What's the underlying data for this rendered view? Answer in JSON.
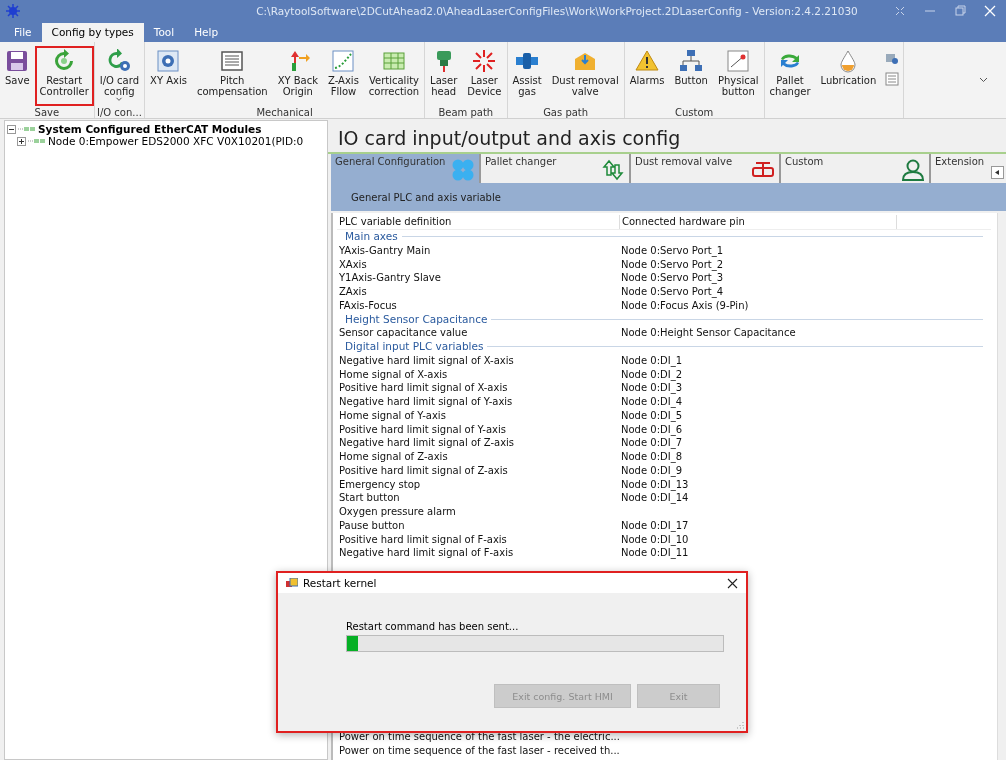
{
  "window": {
    "title": "C:\\RaytoolSoftware\\2DCutAhead2.0\\AheadLaserConfigFiles\\Work\\WorkProject.2DLaserConfig - Version:2.4.2.21030"
  },
  "menu_tabs": [
    {
      "label": "File",
      "selected": false
    },
    {
      "label": "Config by types",
      "selected": true
    },
    {
      "label": "Tool",
      "selected": false
    },
    {
      "label": "Help",
      "selected": false
    }
  ],
  "ribbon": {
    "groups": [
      {
        "label": "Save",
        "buttons": [
          {
            "label": "Save",
            "highlighted": false,
            "dropdown": false
          },
          {
            "label": "Restart\nController",
            "highlighted": true,
            "dropdown": false
          }
        ]
      },
      {
        "label": "I/O con...",
        "buttons": [
          {
            "label": "I/O card\nconfig",
            "highlighted": false,
            "dropdown": true
          }
        ]
      },
      {
        "label": "Mechanical",
        "buttons": [
          {
            "label": "XY Axis",
            "highlighted": false,
            "dropdown": false
          },
          {
            "label": "Pitch\ncompensation",
            "highlighted": false,
            "dropdown": false
          },
          {
            "label": "XY Back\nOrigin",
            "highlighted": false,
            "dropdown": false
          },
          {
            "label": "Z-Axis\nFllow",
            "highlighted": false,
            "dropdown": false
          },
          {
            "label": "Verticality\ncorrection",
            "highlighted": false,
            "dropdown": false
          }
        ]
      },
      {
        "label": "Beam path",
        "buttons": [
          {
            "label": "Laser\nhead",
            "highlighted": false,
            "dropdown": false
          },
          {
            "label": "Laser\nDevice",
            "highlighted": false,
            "dropdown": false
          }
        ]
      },
      {
        "label": "Gas path",
        "buttons": [
          {
            "label": "Assist\ngas",
            "highlighted": false,
            "dropdown": false
          },
          {
            "label": "Dust removal\nvalve",
            "highlighted": false,
            "dropdown": false
          }
        ]
      },
      {
        "label": "Custom",
        "buttons": [
          {
            "label": "Alarms",
            "highlighted": false,
            "dropdown": false
          },
          {
            "label": "Button",
            "highlighted": false,
            "dropdown": false
          },
          {
            "label": "Physical\nbutton",
            "highlighted": false,
            "dropdown": false
          }
        ]
      },
      {
        "buttons": [
          {
            "label": "Pallet\nchanger",
            "highlighted": false,
            "dropdown": false
          },
          {
            "label": "Lubrication",
            "highlighted": false,
            "dropdown": false
          }
        ]
      }
    ]
  },
  "tree": [
    {
      "label": "System Configured EtherCAT Modules",
      "expanded": true,
      "children": [
        {
          "label": "Node 0:Empower EDS2000 XFC V0X10201(PID:0",
          "expanded": false
        }
      ]
    }
  ],
  "panel": {
    "title": "IO card input/output and axis config",
    "tabs": [
      {
        "label": "General Configuration",
        "selected": true
      },
      {
        "label": "Pallet changer",
        "selected": false
      },
      {
        "label": "Dust removal valve",
        "selected": false
      },
      {
        "label": "Custom",
        "selected": false
      },
      {
        "label": "Extension",
        "selected": false
      }
    ],
    "band_label": "General PLC and axis variable",
    "table": {
      "columns": [
        "PLC variable definition",
        "Connected hardware pin"
      ],
      "rows": [
        {
          "kind": "section",
          "label": "Main axes"
        },
        {
          "kind": "row",
          "cells": [
            "YAxis-Gantry Main",
            "Node 0:Servo Port_1"
          ]
        },
        {
          "kind": "row",
          "cells": [
            "XAxis",
            "Node 0:Servo Port_2"
          ]
        },
        {
          "kind": "row",
          "cells": [
            "Y1Axis-Gantry Slave",
            "Node 0:Servo Port_3"
          ]
        },
        {
          "kind": "row",
          "cells": [
            "ZAxis",
            "Node 0:Servo Port_4"
          ]
        },
        {
          "kind": "row",
          "cells": [
            "FAxis-Focus",
            "Node 0:Focus Axis (9-Pin)"
          ]
        },
        {
          "kind": "section",
          "label": "Height Sensor Capacitance"
        },
        {
          "kind": "row",
          "cells": [
            "Sensor capacitance value",
            "Node 0:Height Sensor Capacitance"
          ]
        },
        {
          "kind": "section",
          "label": "Digital input PLC variables"
        },
        {
          "kind": "row",
          "cells": [
            "Negative hard limit signal of X-axis",
            "Node 0:DI_1"
          ]
        },
        {
          "kind": "row",
          "cells": [
            "Home signal of X-axis",
            "Node 0:DI_2"
          ]
        },
        {
          "kind": "row",
          "cells": [
            "Positive hard limit signal of X-axis",
            "Node 0:DI_3"
          ]
        },
        {
          "kind": "row",
          "cells": [
            "Negative hard limit signal of Y-axis",
            "Node 0:DI_4"
          ]
        },
        {
          "kind": "row",
          "cells": [
            "Home signal of Y-axis",
            "Node 0:DI_5"
          ]
        },
        {
          "kind": "row",
          "cells": [
            "Positive hard limit signal of Y-axis",
            "Node 0:DI_6"
          ]
        },
        {
          "kind": "row",
          "cells": [
            "Negative hard limit signal of Z-axis",
            "Node 0:DI_7"
          ]
        },
        {
          "kind": "row",
          "cells": [
            "Home signal of Z-axis",
            "Node 0:DI_8"
          ]
        },
        {
          "kind": "row",
          "cells": [
            "Positive hard limit signal of Z-axis",
            "Node 0:DI_9"
          ]
        },
        {
          "kind": "row",
          "cells": [
            "Emergency stop",
            "Node 0:DI_13"
          ]
        },
        {
          "kind": "row",
          "cells": [
            "Start button",
            "Node 0:DI_14"
          ]
        },
        {
          "kind": "row",
          "cells": [
            "Oxygen pressure alarm"
          ]
        },
        {
          "kind": "row",
          "cells": [
            "Pause button",
            "Node 0:DI_17"
          ]
        },
        {
          "kind": "row",
          "cells": [
            "Positive hard limit signal of F-axis",
            "Node 0:DI_10"
          ]
        },
        {
          "kind": "row",
          "cells": [
            "Negative hard limit signal of F-axis",
            "Node 0:DI_11"
          ]
        },
        {
          "kind": "gap"
        },
        {
          "kind": "row",
          "cells": [
            "Power on time sequence of the fast laser - the electric..."
          ]
        },
        {
          "kind": "row",
          "cells": [
            "Power on time sequence of the fast laser - received th..."
          ]
        }
      ]
    }
  },
  "dialog": {
    "title": "Restart kernel",
    "message": "Restart command has been sent...",
    "progress": {
      "level": 0.03
    },
    "buttons": [
      {
        "label": "Exit config. Start HMI",
        "disabled": true
      },
      {
        "label": "Exit",
        "disabled": true
      }
    ]
  }
}
